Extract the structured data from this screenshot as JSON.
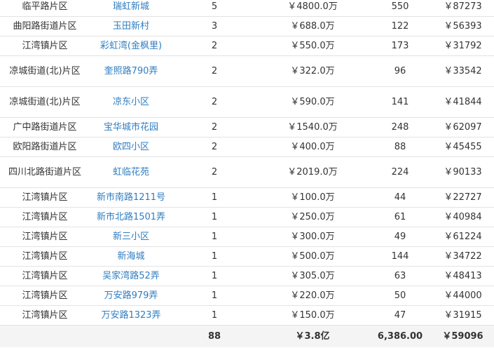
{
  "rows": [
    {
      "district": "临平路片区",
      "community": "瑞虹新城",
      "count": "5",
      "total_price": "￥4800.0万",
      "area": "550",
      "unit_price": "￥87273",
      "two_line": false
    },
    {
      "district": "曲阳路街道片区",
      "community": "玉田新村",
      "count": "3",
      "total_price": "￥688.0万",
      "area": "122",
      "unit_price": "￥56393",
      "two_line": false
    },
    {
      "district": "江湾镇片区",
      "community": "彩虹湾(金枫里)",
      "count": "2",
      "total_price": "￥550.0万",
      "area": "173",
      "unit_price": "￥31792",
      "two_line": false
    },
    {
      "district": "凉城街道(北)片区",
      "community": "奎照路790弄",
      "count": "2",
      "total_price": "￥322.0万",
      "area": "96",
      "unit_price": "￥33542",
      "two_line": true
    },
    {
      "district": "凉城街道(北)片区",
      "community": "凉东小区",
      "count": "2",
      "total_price": "￥590.0万",
      "area": "141",
      "unit_price": "￥41844",
      "two_line": true
    },
    {
      "district": "广中路街道片区",
      "community": "宝华城市花园",
      "count": "2",
      "total_price": "￥1540.0万",
      "area": "248",
      "unit_price": "￥62097",
      "two_line": false
    },
    {
      "district": "欧阳路街道片区",
      "community": "欧四小区",
      "count": "2",
      "total_price": "￥400.0万",
      "area": "88",
      "unit_price": "￥45455",
      "two_line": false
    },
    {
      "district": "四川北路街道片区",
      "community": "虹临花苑",
      "count": "2",
      "total_price": "￥2019.0万",
      "area": "224",
      "unit_price": "￥90133",
      "two_line": true
    },
    {
      "district": "江湾镇片区",
      "community": "新市南路1211号",
      "count": "1",
      "total_price": "￥100.0万",
      "area": "44",
      "unit_price": "￥22727",
      "two_line": false
    },
    {
      "district": "江湾镇片区",
      "community": "新市北路1501弄",
      "count": "1",
      "total_price": "￥250.0万",
      "area": "61",
      "unit_price": "￥40984",
      "two_line": false
    },
    {
      "district": "江湾镇片区",
      "community": "新三小区",
      "count": "1",
      "total_price": "￥300.0万",
      "area": "49",
      "unit_price": "￥61224",
      "two_line": false
    },
    {
      "district": "江湾镇片区",
      "community": "新海城",
      "count": "1",
      "total_price": "￥500.0万",
      "area": "144",
      "unit_price": "￥34722",
      "two_line": false
    },
    {
      "district": "江湾镇片区",
      "community": "吴家湾路52弄",
      "count": "1",
      "total_price": "￥305.0万",
      "area": "63",
      "unit_price": "￥48413",
      "two_line": false
    },
    {
      "district": "江湾镇片区",
      "community": "万安路979弄",
      "count": "1",
      "total_price": "￥220.0万",
      "area": "50",
      "unit_price": "￥44000",
      "two_line": false
    },
    {
      "district": "江湾镇片区",
      "community": "万安路1323弄",
      "count": "1",
      "total_price": "￥150.0万",
      "area": "47",
      "unit_price": "￥31915",
      "two_line": false
    }
  ],
  "totals": {
    "district": "",
    "community": "",
    "count": "88",
    "total_price": "￥3.8亿",
    "area": "6,386.00",
    "unit_price": "￥59096"
  }
}
